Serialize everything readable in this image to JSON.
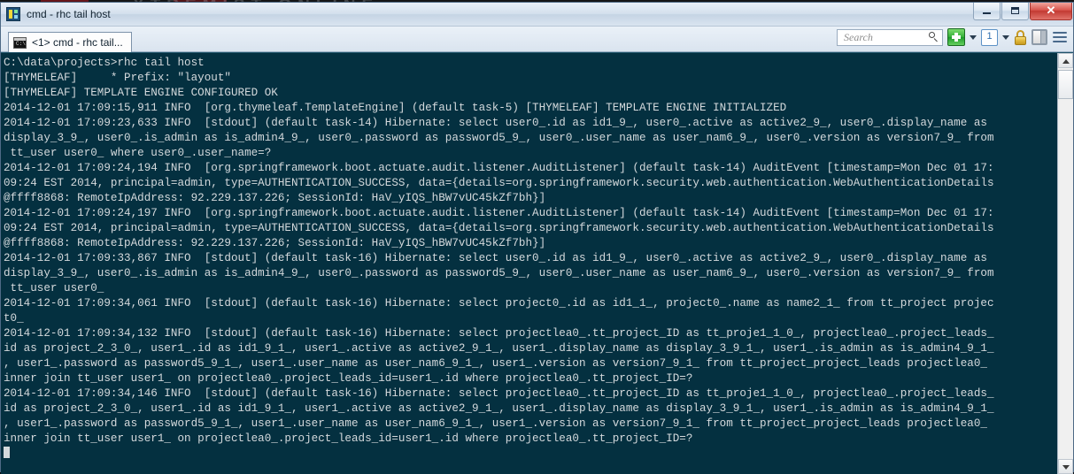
{
  "backdrop": {
    "ghost_banner_text": "XTREMIST ONLINE"
  },
  "window": {
    "title": "cmd - rhc  tail host",
    "app_icon": "console-app-icon",
    "controls": {
      "minimize_label": "–",
      "maximize_label": "□",
      "close_label": "✕"
    }
  },
  "tabbar": {
    "tabs": [
      {
        "label": "<1> cmd - rhc  tail...",
        "icon": "console-icon",
        "icon_text": "C:\\",
        "active": true
      }
    ]
  },
  "toolbar": {
    "search": {
      "placeholder": "Search",
      "value": "",
      "icon": "search-icon"
    },
    "new_tab": {
      "icon": "green-plus-icon",
      "label": ""
    },
    "new_tab_caret": {
      "icon": "chevron-down-icon"
    },
    "session_count": {
      "icon": "numbered-box-icon",
      "label": "1"
    },
    "session_caret": {
      "icon": "chevron-down-icon"
    },
    "lock": {
      "icon": "lock-icon"
    },
    "panel": {
      "icon": "split-panel-icon"
    },
    "menu": {
      "icon": "hamburger-menu-icon"
    }
  },
  "console": {
    "prompt": "C:\\data\\projects>",
    "command": "rhc tail host",
    "cursor_visible": true,
    "lines": [
      "C:\\data\\projects>rhc tail host",
      "[THYMELEAF]     * Prefix: \"layout\"",
      "[THYMELEAF] TEMPLATE ENGINE CONFIGURED OK",
      "2014-12-01 17:09:15,911 INFO  [org.thymeleaf.TemplateEngine] (default task-5) [THYMELEAF] TEMPLATE ENGINE INITIALIZED",
      "2014-12-01 17:09:23,633 INFO  [stdout] (default task-14) Hibernate: select user0_.id as id1_9_, user0_.active as active2_9_, user0_.display_name as",
      "display_3_9_, user0_.is_admin as is_admin4_9_, user0_.password as password5_9_, user0_.user_name as user_nam6_9_, user0_.version as version7_9_ from",
      " tt_user user0_ where user0_.user_name=?",
      "2014-12-01 17:09:24,194 INFO  [org.springframework.boot.actuate.audit.listener.AuditListener] (default task-14) AuditEvent [timestamp=Mon Dec 01 17:",
      "09:24 EST 2014, principal=admin, type=AUTHENTICATION_SUCCESS, data={details=org.springframework.security.web.authentication.WebAuthenticationDetails",
      "@ffff8868: RemoteIpAddress: 92.229.137.226; SessionId: HaV_yIQS_hBW7vUC45kZf7bh}]",
      "2014-12-01 17:09:24,197 INFO  [org.springframework.boot.actuate.audit.listener.AuditListener] (default task-14) AuditEvent [timestamp=Mon Dec 01 17:",
      "09:24 EST 2014, principal=admin, type=AUTHENTICATION_SUCCESS, data={details=org.springframework.security.web.authentication.WebAuthenticationDetails",
      "@ffff8868: RemoteIpAddress: 92.229.137.226; SessionId: HaV_yIQS_hBW7vUC45kZf7bh}]",
      "2014-12-01 17:09:33,867 INFO  [stdout] (default task-16) Hibernate: select user0_.id as id1_9_, user0_.active as active2_9_, user0_.display_name as",
      "display_3_9_, user0_.is_admin as is_admin4_9_, user0_.password as password5_9_, user0_.user_name as user_nam6_9_, user0_.version as version7_9_ from",
      " tt_user user0_",
      "2014-12-01 17:09:34,061 INFO  [stdout] (default task-16) Hibernate: select project0_.id as id1_1_, project0_.name as name2_1_ from tt_project projec",
      "t0_",
      "2014-12-01 17:09:34,132 INFO  [stdout] (default task-16) Hibernate: select projectlea0_.tt_project_ID as tt_proje1_1_0_, projectlea0_.project_leads_",
      "id as project_2_3_0_, user1_.id as id1_9_1_, user1_.active as active2_9_1_, user1_.display_name as display_3_9_1_, user1_.is_admin as is_admin4_9_1_",
      ", user1_.password as password5_9_1_, user1_.user_name as user_nam6_9_1_, user1_.version as version7_9_1_ from tt_project_project_leads projectlea0_",
      "inner join tt_user user1_ on projectlea0_.project_leads_id=user1_.id where projectlea0_.tt_project_ID=?",
      "2014-12-01 17:09:34,146 INFO  [stdout] (default task-16) Hibernate: select projectlea0_.tt_project_ID as tt_proje1_1_0_, projectlea0_.project_leads_",
      "id as project_2_3_0_, user1_.id as id1_9_1_, user1_.active as active2_9_1_, user1_.display_name as display_3_9_1_, user1_.is_admin as is_admin4_9_1_",
      ", user1_.password as password5_9_1_, user1_.user_name as user_nam6_9_1_, user1_.version as version7_9_1_ from tt_project_project_leads projectlea0_",
      "inner join tt_user user1_ on projectlea0_.project_leads_id=user1_.id where projectlea0_.tt_project_ID=?"
    ]
  },
  "scrollbar": {
    "up_arrow": "scroll-up-icon",
    "down_arrow": "scroll-down-icon",
    "thumb": "scroll-thumb"
  },
  "colors": {
    "console_bg": "#043040",
    "console_fg": "#d4d9dc",
    "accent_green": "#36b23a",
    "accent_close_red": "#c23a32",
    "lock_gold": "#e0b63a",
    "chrome_bg": "#dae4ef"
  }
}
